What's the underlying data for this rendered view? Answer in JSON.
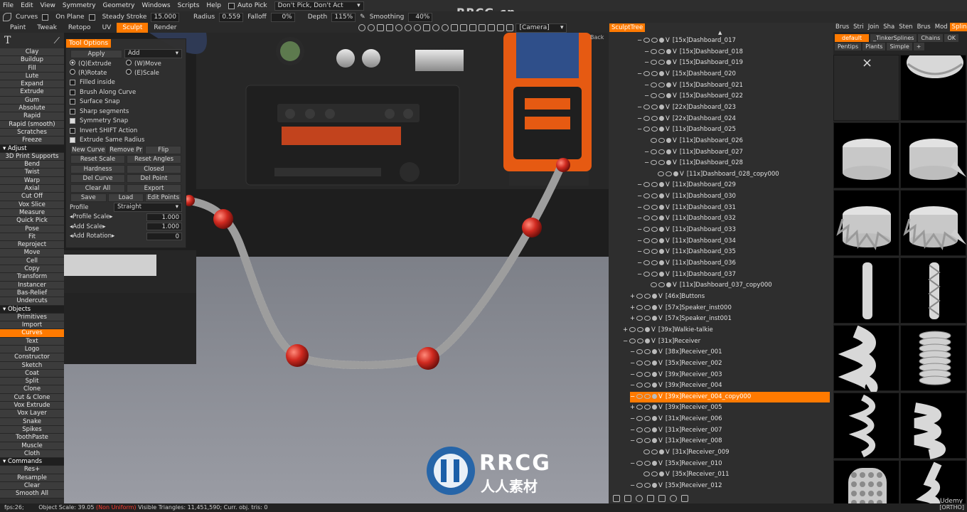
{
  "menu": {
    "items": [
      "File",
      "Edit",
      "View",
      "Symmetry",
      "Geometry",
      "Windows",
      "Scripts",
      "Help"
    ],
    "auto_pick": "Auto Pick",
    "pick_mode": "Don't Pick, Don't Act"
  },
  "options_bar": {
    "curves": "Curves",
    "on_plane": "On Plane",
    "steady_stroke": "Steady Stroke",
    "steady_value": "15.000",
    "radius": "Radius",
    "radius_value": "0.559",
    "falloff": "Falloff",
    "falloff_value": "0%",
    "depth": "Depth",
    "depth_value": "115%",
    "smoothing": "Smoothing",
    "smoothing_value": "40%"
  },
  "rooms": [
    "Paint",
    "Tweak",
    "Retopo",
    "UV",
    "Sculpt",
    "Render"
  ],
  "active_room": "Sculpt",
  "camera": "[Camera]",
  "back_label": "Back",
  "left_tools": [
    {
      "label": "Clay"
    },
    {
      "label": "Buildup"
    },
    {
      "label": "Fill"
    },
    {
      "label": "Lute"
    },
    {
      "label": "Expand"
    },
    {
      "label": "Extrude"
    },
    {
      "label": "Gum"
    },
    {
      "label": "Absolute"
    },
    {
      "label": "Rapid"
    },
    {
      "label": "Rapid (smooth)"
    },
    {
      "label": "Scratches"
    },
    {
      "label": "Freeze"
    },
    {
      "label": "Adjust",
      "head": true
    },
    {
      "label": "3D Print Supports"
    },
    {
      "label": "Bend"
    },
    {
      "label": "Twist"
    },
    {
      "label": "Warp"
    },
    {
      "label": "Axial"
    },
    {
      "label": "Cut Off"
    },
    {
      "label": "Vox Slice"
    },
    {
      "label": "Measure"
    },
    {
      "label": "Quick Pick"
    },
    {
      "label": "Pose"
    },
    {
      "label": "Fit"
    },
    {
      "label": "Reproject"
    },
    {
      "label": "Move"
    },
    {
      "label": "Cell"
    },
    {
      "label": "Copy"
    },
    {
      "label": "Transform"
    },
    {
      "label": "Instancer"
    },
    {
      "label": "Bas-Relief"
    },
    {
      "label": "Undercuts"
    },
    {
      "label": "Objects",
      "head": true
    },
    {
      "label": "Primitives"
    },
    {
      "label": "Import"
    },
    {
      "label": "Curves",
      "active": true
    },
    {
      "label": "Text"
    },
    {
      "label": "Logo"
    },
    {
      "label": "Constructor"
    },
    {
      "label": "Sketch"
    },
    {
      "label": "Coat"
    },
    {
      "label": "Split"
    },
    {
      "label": "Clone"
    },
    {
      "label": "Cut & Clone"
    },
    {
      "label": "Vox Extrude"
    },
    {
      "label": "Vox Layer"
    },
    {
      "label": "Snake"
    },
    {
      "label": "Spikes"
    },
    {
      "label": "ToothPaste"
    },
    {
      "label": "Muscle"
    },
    {
      "label": "Cloth"
    },
    {
      "label": "Commands",
      "head": true
    },
    {
      "label": "Res+"
    },
    {
      "label": "Resample"
    },
    {
      "label": "Clear"
    },
    {
      "label": "Smooth All"
    }
  ],
  "tool_options": {
    "title": "Tool Options",
    "apply": "Apply",
    "mode": "Add",
    "extrude": "(Q)Extrude",
    "move": "(W)Move",
    "rotate": "(R)Rotate",
    "scale": "(E)Scale",
    "checks": [
      {
        "label": "Filled inside",
        "on": false
      },
      {
        "label": "Brush Along Curve",
        "on": false
      },
      {
        "label": "Surface Snap",
        "on": false
      },
      {
        "label": "Sharp segments",
        "on": false
      },
      {
        "label": "Symmetry Snap",
        "on": true
      },
      {
        "label": "Invert SHIFT Action",
        "on": false
      },
      {
        "label": "Extrude Same Radius",
        "on": true
      }
    ],
    "btn_rows": [
      [
        "New Curve",
        "Remove Pr",
        "Flip"
      ],
      [
        "Reset Scale",
        "Reset Angles"
      ],
      [
        "Hardness",
        "Closed"
      ],
      [
        "Del Curve",
        "Del Point"
      ],
      [
        "Clear All",
        "Export"
      ],
      [
        "Save",
        "Load",
        "Edit Points"
      ]
    ],
    "profile_label": "Profile",
    "profile_value": "Straight",
    "params": [
      {
        "label": "Profile Scale",
        "value": "1.000"
      },
      {
        "label": "Add Scale",
        "value": "1.000"
      },
      {
        "label": "Add Rotation",
        "value": "0"
      }
    ]
  },
  "tree": {
    "title": "SculptTree",
    "rows": [
      {
        "label": "[15x]Dashboard_017",
        "indent": 2,
        "sign": "-"
      },
      {
        "label": "[15x]Dashboard_018",
        "indent": 3,
        "sign": "-"
      },
      {
        "label": "[15x]Dashboard_019",
        "indent": 3,
        "sign": "-"
      },
      {
        "label": "[15x]Dashboard_020",
        "indent": 2,
        "sign": "-"
      },
      {
        "label": "[15x]Dashboard_021",
        "indent": 3,
        "sign": "-"
      },
      {
        "label": "[15x]Dashboard_022",
        "indent": 3,
        "sign": "-"
      },
      {
        "label": "[22x]Dashboard_023",
        "indent": 2,
        "sign": "-"
      },
      {
        "label": "[22x]Dashboard_024",
        "indent": 2,
        "sign": "-"
      },
      {
        "label": "[11x]Dashboard_025",
        "indent": 2,
        "sign": "-"
      },
      {
        "label": "[11x]Dashboard_026",
        "indent": 3,
        "sign": ""
      },
      {
        "label": "[11x]Dashboard_027",
        "indent": 3,
        "sign": "-"
      },
      {
        "label": "[11x]Dashboard_028",
        "indent": 3,
        "sign": "-"
      },
      {
        "label": "[11x]Dashboard_028_copy000",
        "indent": 4,
        "sign": ""
      },
      {
        "label": "[11x]Dashboard_029",
        "indent": 2,
        "sign": "-"
      },
      {
        "label": "[11x]Dashboard_030",
        "indent": 2,
        "sign": "-"
      },
      {
        "label": "[11x]Dashboard_031",
        "indent": 2,
        "sign": "-"
      },
      {
        "label": "[11x]Dashboard_032",
        "indent": 2,
        "sign": "-"
      },
      {
        "label": "[11x]Dashboard_033",
        "indent": 2,
        "sign": "-"
      },
      {
        "label": "[11x]Dashboard_034",
        "indent": 2,
        "sign": "-"
      },
      {
        "label": "[11x]Dashboard_035",
        "indent": 2,
        "sign": "-"
      },
      {
        "label": "[11x]Dashboard_036",
        "indent": 2,
        "sign": "-"
      },
      {
        "label": "[11x]Dashboard_037",
        "indent": 2,
        "sign": "-"
      },
      {
        "label": "[11x]Dashboard_037_copy000",
        "indent": 3,
        "sign": ""
      },
      {
        "label": "[46x]Buttons",
        "indent": 1,
        "sign": "+"
      },
      {
        "label": "[57x]Speaker_inst000",
        "indent": 1,
        "sign": "+"
      },
      {
        "label": "[57x]Speaker_inst001",
        "indent": 1,
        "sign": "+"
      },
      {
        "label": "[39x]Walkie-talkie",
        "indent": 0,
        "sign": "+"
      },
      {
        "label": "[31x]Receiver",
        "indent": 0,
        "sign": "-"
      },
      {
        "label": "[38x]Receiver_001",
        "indent": 1,
        "sign": "-"
      },
      {
        "label": "[35x]Receiver_002",
        "indent": 1,
        "sign": "-"
      },
      {
        "label": "[39x]Receiver_003",
        "indent": 1,
        "sign": "-"
      },
      {
        "label": "[39x]Receiver_004",
        "indent": 1,
        "sign": "-"
      },
      {
        "label": "[39x]Receiver_004_copy000",
        "indent": 1,
        "sign": "-",
        "selected": true
      },
      {
        "label": "[39x]Receiver_005",
        "indent": 1,
        "sign": "+"
      },
      {
        "label": "[31x]Receiver_006",
        "indent": 1,
        "sign": "-"
      },
      {
        "label": "[31x]Receiver_007",
        "indent": 1,
        "sign": "-"
      },
      {
        "label": "[31x]Receiver_008",
        "indent": 1,
        "sign": "-"
      },
      {
        "label": "[31x]Receiver_009",
        "indent": 2,
        "sign": ""
      },
      {
        "label": "[35x]Receiver_010",
        "indent": 1,
        "sign": "-"
      },
      {
        "label": "[35x]Receiver_011",
        "indent": 2,
        "sign": ""
      },
      {
        "label": "[35x]Receiver_012",
        "indent": 1,
        "sign": "-"
      }
    ]
  },
  "splines": {
    "tabs": [
      "Brus",
      "Stri",
      "Join",
      "Sha",
      "Sten",
      "Brus",
      "Mod",
      "Splines"
    ],
    "active_tab": "Splines",
    "presets": [
      "default",
      "_TinkerSplines",
      "Chains",
      "OK"
    ],
    "presets2": [
      "Pentips",
      "Plants",
      "Simple",
      "+"
    ],
    "close": "×"
  },
  "status": {
    "fps": "fps:26;",
    "scale": "Object Scale: 39.05",
    "non_uniform": "(Non Uniform)",
    "triangles": "Visible Triangles: 11,451,590; Curr. obj. tris: 0"
  },
  "corner_label": "[ORTHO]",
  "watermark_top": "RRCG.cn",
  "watermark_brand": "RRCG",
  "watermark_sub": "人人素材",
  "udemy": "Udemy",
  "colors": {
    "accent": "#ff7a00",
    "panel": "#2e2e2e",
    "viewport_floor": "#8e919a"
  }
}
